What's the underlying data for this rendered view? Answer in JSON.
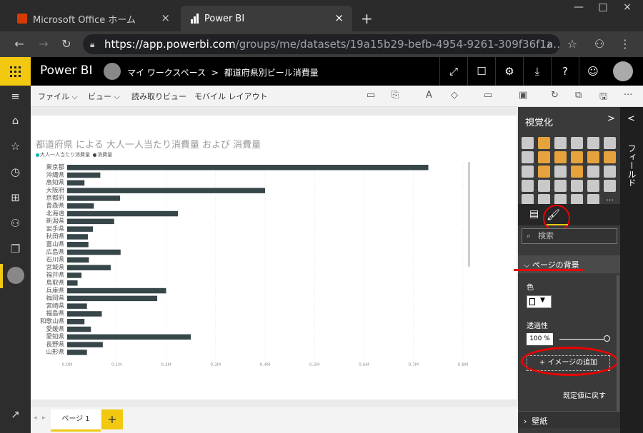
{
  "browser": {
    "tabs": [
      {
        "title": "Microsoft Office ホーム",
        "close": "×"
      },
      {
        "title": "Power BI",
        "close": "×"
      }
    ],
    "new_tab": "+",
    "window_controls": [
      "—",
      "□",
      "×"
    ],
    "url_host": "https://app.powerbi.com",
    "url_path": "/groups/me/datasets/19a15b29-befb-4954-9261-309f36f1a…"
  },
  "app": {
    "name": "Power BI",
    "breadcrumb_workspace": "マイ ワークスペース",
    "breadcrumb_sep": ">",
    "breadcrumb_report": "都道府県別ビール消費量"
  },
  "menu": {
    "items": [
      "ファイル ⌵",
      "ビュー ⌵",
      "読み取りビュー",
      "モバイル レイアウト"
    ],
    "more": "···"
  },
  "chart_data": {
    "type": "bar",
    "orientation": "horizontal",
    "title": "都道府県 による 大人一人当たり消費量 および 消費量",
    "legend": [
      "大人一人当たり消費量",
      "消費量"
    ],
    "legend_colors": [
      "#01b8aa",
      "#374649"
    ],
    "categories": [
      "東京都",
      "沖縄県",
      "高知県",
      "大阪府",
      "京都府",
      "青森県",
      "北海道",
      "新潟県",
      "岩手県",
      "秋田県",
      "富山県",
      "広島県",
      "石川県",
      "宮城県",
      "福井県",
      "鳥取県",
      "兵庫県",
      "福岡県",
      "宮崎県",
      "福島県",
      "和歌山県",
      "愛媛県",
      "愛知県",
      "長野県",
      "山形県"
    ],
    "values": [
      730000,
      67000,
      35000,
      400000,
      107000,
      54000,
      224000,
      95000,
      52000,
      42000,
      43000,
      108000,
      44000,
      88000,
      29000,
      21000,
      200000,
      182000,
      40000,
      70000,
      35000,
      48000,
      250000,
      72000,
      40000
    ],
    "xticks": [
      "0.0M",
      "0.1M",
      "0.2M",
      "0.3M",
      "0.4M",
      "0.5M",
      "0.6M",
      "0.7M",
      "0.8M"
    ],
    "xlim": [
      0,
      800000
    ],
    "bar_color": "#374649",
    "grid": true
  },
  "pages": {
    "tab": "ページ 1",
    "add": "+",
    "nav_prev": "◂",
    "nav_next": "▸"
  },
  "viz": {
    "title": "視覚化",
    "expand": ">",
    "fields_collapse": "<",
    "fields_label": "フィールド",
    "more_visuals": "···",
    "search_placeholder": "検索",
    "section_page_bg": "ページの背景",
    "color_label": "色",
    "transparency_label": "透過性",
    "transparency_value": "100 %",
    "add_image": "+ イメージの追加",
    "reset": "既定値に戻す",
    "section_wallpaper": "壁紙"
  }
}
